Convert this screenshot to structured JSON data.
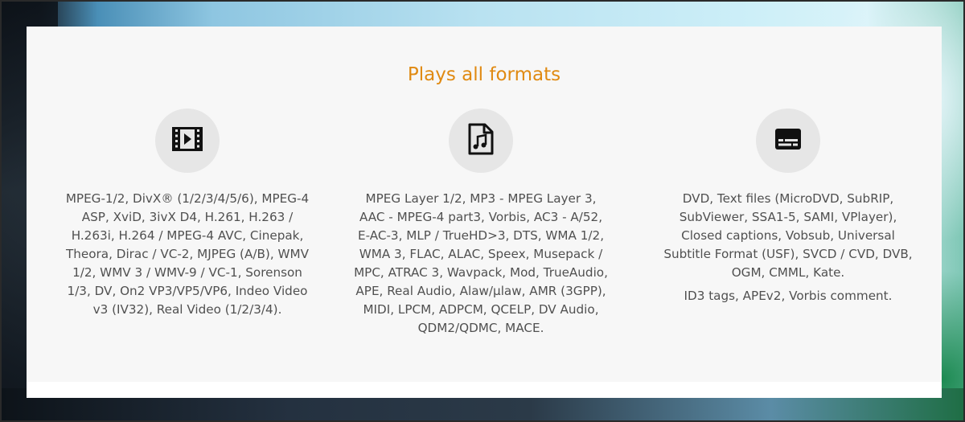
{
  "section": {
    "title": "Plays all formats"
  },
  "columns": [
    {
      "icon": "film-icon",
      "text": "MPEG-1/2, DivX® (1/2/3/4/5/6), MPEG-4 ASP, XviD, 3ivX D4, H.261, H.263 / H.263i, H.264 / MPEG-4 AVC, Cinepak, Theora, Dirac / VC-2, MJPEG (A/B), WMV 1/2, WMV 3 / WMV-9 / VC-1, Sorenson 1/3, DV, On2 VP3/VP5/VP6, Indeo Video v3 (IV32), Real Video (1/2/3/4)."
    },
    {
      "icon": "audio-file-icon",
      "text": "MPEG Layer 1/2, MP3 - MPEG Layer 3, AAC - MPEG-4 part3, Vorbis, AC3 - A/52, E-AC-3, MLP / TrueHD>3, DTS, WMA 1/2, WMA 3, FLAC, ALAC, Speex, Musepack / MPC, ATRAC 3, Wavpack, Mod, TrueAudio, APE, Real Audio, Alaw/µlaw, AMR (3GPP), MIDI, LPCM, ADPCM, QCELP, DV Audio, QDM2/QDMC, MACE."
    },
    {
      "icon": "subtitles-icon",
      "text": "DVD, Text files (MicroDVD, SubRIP, SubViewer, SSA1-5, SAMI, VPlayer), Closed captions, Vobsub, Universal Subtitle Format (USF), SVCD / CVD, DVB, OGM, CMML, Kate.",
      "extra_text": "ID3 tags, APEv2, Vorbis comment."
    }
  ],
  "colors": {
    "title": "#e08a12",
    "text": "#505050",
    "panel_bg": "#f7f7f7",
    "icon_circle": "#e6e6e6"
  }
}
